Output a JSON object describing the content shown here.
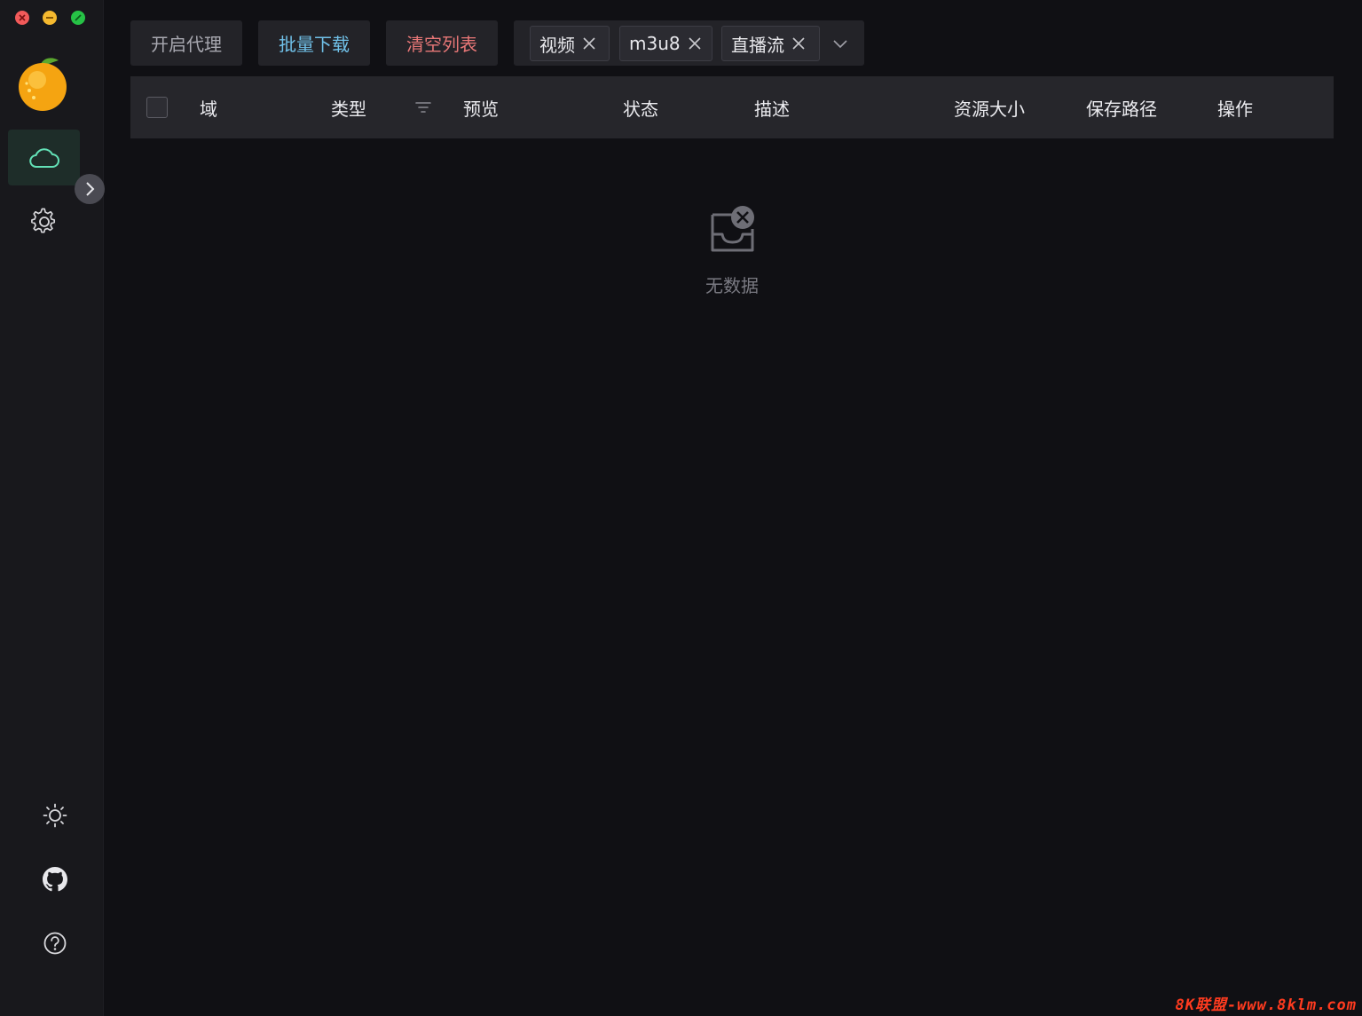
{
  "window": {
    "controls": {
      "close_icon": "close-icon",
      "minimize_icon": "minimize-icon",
      "maximize_icon": "maximize-icon"
    }
  },
  "sidebar": {
    "logo_icon": "orange-logo-icon",
    "nav": [
      {
        "icon": "cloud-icon",
        "active": true
      },
      {
        "icon": "gear-icon",
        "active": false
      }
    ],
    "collapse_icon": "chevron-right-icon",
    "bottom": [
      {
        "icon": "sun-icon"
      },
      {
        "icon": "github-icon"
      },
      {
        "icon": "help-icon"
      }
    ]
  },
  "toolbar": {
    "proxy_label": "开启代理",
    "batch_download_label": "批量下载",
    "clear_list_label": "清空列表",
    "filter_tags": [
      "视频",
      "m3u8",
      "直播流"
    ]
  },
  "table": {
    "columns": [
      "域",
      "类型",
      "预览",
      "状态",
      "描述",
      "资源大小",
      "保存路径",
      "操作"
    ],
    "rows": []
  },
  "empty_state": {
    "text": "无数据"
  },
  "watermark": "8K联盟-www.8klm.com",
  "colors": {
    "accent_green": "#63e2b7",
    "accent_blue": "#70c0e8",
    "danger_red": "#e87777"
  }
}
